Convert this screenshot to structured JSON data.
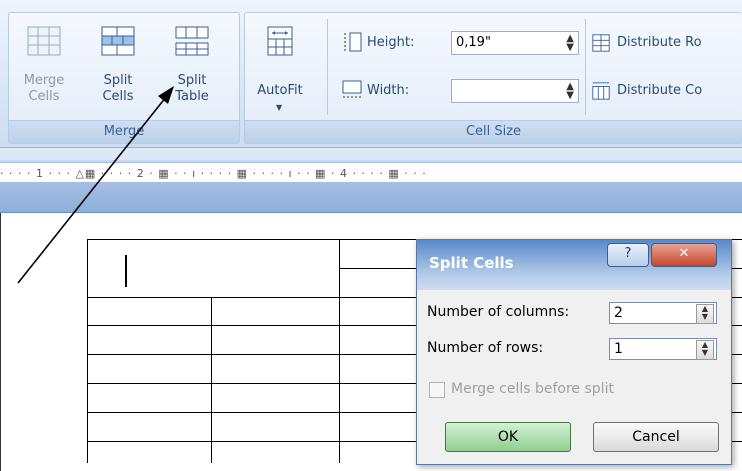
{
  "ribbon": {
    "merge_group": {
      "label": "Merge",
      "merge_cells": "Merge\nCells",
      "split_cells": "Split\nCells",
      "split_table": "Split\nTable"
    },
    "cellsize_group": {
      "label": "Cell Size",
      "autofit": "AutoFit",
      "height_label": "Height:",
      "height_value": "0,19\"",
      "width_label": "Width:",
      "width_value": "",
      "distribute_rows": "Distribute Ro",
      "distribute_cols": "Distribute Co"
    }
  },
  "ruler": {
    "marks": "· · · · 1 · · · △▦ · · · · 2 · ▦ · · ı · · · · ▦ · · · · ı · · ▦ · 4 · · · · ▦ · · ·"
  },
  "dialog": {
    "title": "Split Cells",
    "help": "?",
    "close": "✕",
    "columns_label": "Number of columns:",
    "columns_value": "2",
    "rows_label": "Number of rows:",
    "rows_value": "1",
    "merge_label": "Merge cells before split",
    "ok": "OK",
    "cancel": "Cancel"
  },
  "colors": {
    "ribbon_bg": "#dbe8f7",
    "group_label": "#3a5f94",
    "dialog_title": "#5a89ca",
    "ok_button": "#8fcf8f"
  }
}
